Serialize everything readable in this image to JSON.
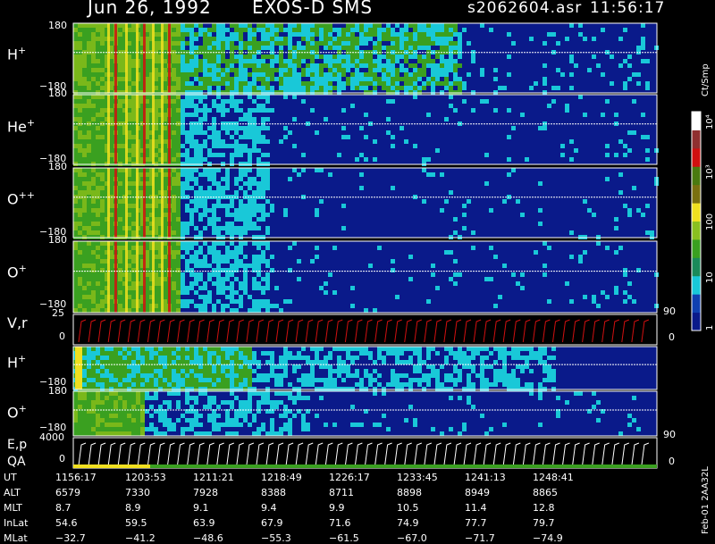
{
  "header": {
    "date": "Jun 26, 1992",
    "instrument": "EXOS-D SMS",
    "file": "s2062604.asr",
    "time": "11:56:17"
  },
  "side": {
    "units": "Ct/Smp",
    "version": "Feb-01  2AA32L"
  },
  "colors": {
    "background": "#000000",
    "dark_blue": "#0a1a8a",
    "cyan": "#19c8d8",
    "green": "#3aa020",
    "yellow": "#f0e020",
    "red": "#d01010",
    "trace": "#ffffff"
  },
  "chart_data": [
    {
      "type": "heatmap",
      "species": "H",
      "charge": "+",
      "ylim": [
        -180,
        180
      ],
      "tick_labels": [
        "180",
        "−180"
      ]
    },
    {
      "type": "heatmap",
      "species": "He",
      "charge": "+",
      "ylim": [
        -180,
        180
      ],
      "tick_labels": [
        "180",
        "−180"
      ]
    },
    {
      "type": "heatmap",
      "species": "O",
      "charge": "++",
      "ylim": [
        -180,
        180
      ],
      "tick_labels": [
        "180",
        "−180"
      ]
    },
    {
      "type": "heatmap",
      "species": "O",
      "charge": "+",
      "ylim": [
        -180,
        180
      ],
      "tick_labels": [
        "180",
        "−180"
      ]
    },
    {
      "type": "line",
      "label": "V,r",
      "ylim": [
        0,
        25
      ],
      "tick_labels": [
        "25",
        "0"
      ],
      "right_ticks": [
        "90",
        "0"
      ]
    },
    {
      "type": "heatmap",
      "species": "H",
      "charge": "+",
      "ylim": [
        -180,
        180
      ],
      "tick_labels": [
        "−180"
      ]
    },
    {
      "type": "heatmap",
      "species": "O",
      "charge": "+",
      "ylim": [
        -180,
        180
      ],
      "tick_labels": [
        "180",
        "−180"
      ]
    },
    {
      "type": "line",
      "label": "E,p",
      "label2": "QA",
      "ylim": [
        0,
        4000
      ],
      "tick_labels": [
        "4000",
        "0"
      ],
      "right_ticks": [
        "90",
        "0"
      ]
    },
    {
      "type": "colorbar",
      "scale": "log",
      "range": [
        1,
        10000
      ],
      "tick_labels": [
        "1",
        "10",
        "100",
        "10³",
        "10⁴"
      ]
    },
    {
      "type": "table",
      "rows": [
        {
          "label": "UT",
          "values": [
            "1156:17",
            "1203:53",
            "1211:21",
            "1218:49",
            "1226:17",
            "1233:45",
            "1241:13",
            "1248:41"
          ]
        },
        {
          "label": "ALT",
          "values": [
            "6579",
            "7330",
            "7928",
            "8388",
            "8711",
            "8898",
            "8949",
            "8865"
          ]
        },
        {
          "label": "MLT",
          "values": [
            "8.7",
            "8.9",
            "9.1",
            "9.4",
            "9.9",
            "10.5",
            "11.4",
            "12.8"
          ]
        },
        {
          "label": "InLat",
          "values": [
            "54.6",
            "59.5",
            "63.9",
            "67.9",
            "71.6",
            "74.9",
            "77.7",
            "79.7"
          ]
        },
        {
          "label": "MLat",
          "values": [
            "−32.7",
            "−41.2",
            "−48.6",
            "−55.3",
            "−61.5",
            "−67.0",
            "−71.7",
            "−74.9"
          ]
        }
      ]
    }
  ]
}
